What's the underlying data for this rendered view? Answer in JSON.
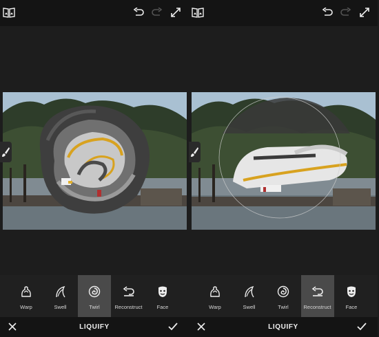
{
  "screens": [
    {
      "tools": [
        {
          "label": "Warp",
          "icon": "warp-icon"
        },
        {
          "label": "Swell",
          "icon": "swell-icon"
        },
        {
          "label": "Twirl",
          "icon": "twirl-icon"
        },
        {
          "label": "Reconstruct",
          "icon": "reconstruct-icon"
        },
        {
          "label": "Face",
          "icon": "face-icon"
        }
      ],
      "active_tool": "Twirl",
      "title": "LIQUIFY"
    },
    {
      "tools": [
        {
          "label": "Warp",
          "icon": "warp-icon"
        },
        {
          "label": "Swell",
          "icon": "swell-icon"
        },
        {
          "label": "Twirl",
          "icon": "twirl-icon"
        },
        {
          "label": "Reconstruct",
          "icon": "reconstruct-icon"
        },
        {
          "label": "Face",
          "icon": "face-icon"
        }
      ],
      "active_tool": "Reconstruct",
      "title": "LIQUIFY"
    }
  ],
  "colors": {
    "accent_active_tool": "#4a4a4a",
    "bar": "#141414",
    "background": "#1d1d1d"
  }
}
